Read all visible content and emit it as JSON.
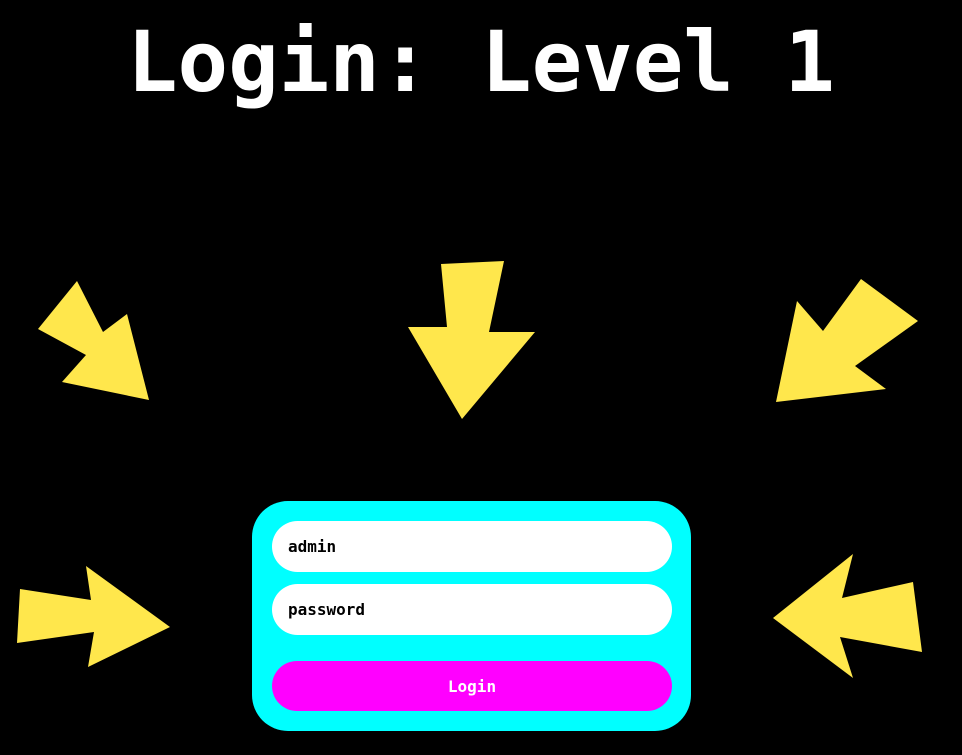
{
  "page": {
    "title": "Login: Level 1"
  },
  "login_form": {
    "username_value": "admin",
    "password_value": "password",
    "submit_label": "Login"
  },
  "colors": {
    "background": "#000000",
    "title": "#ffffff",
    "panel": "#00ffff",
    "field": "#ffffff",
    "button": "#ff00ff",
    "button_text": "#ffffff",
    "arrows": "#ffe74c"
  },
  "decorations": {
    "arrow_icon": "arrow-icon",
    "arrow_count": 5
  }
}
